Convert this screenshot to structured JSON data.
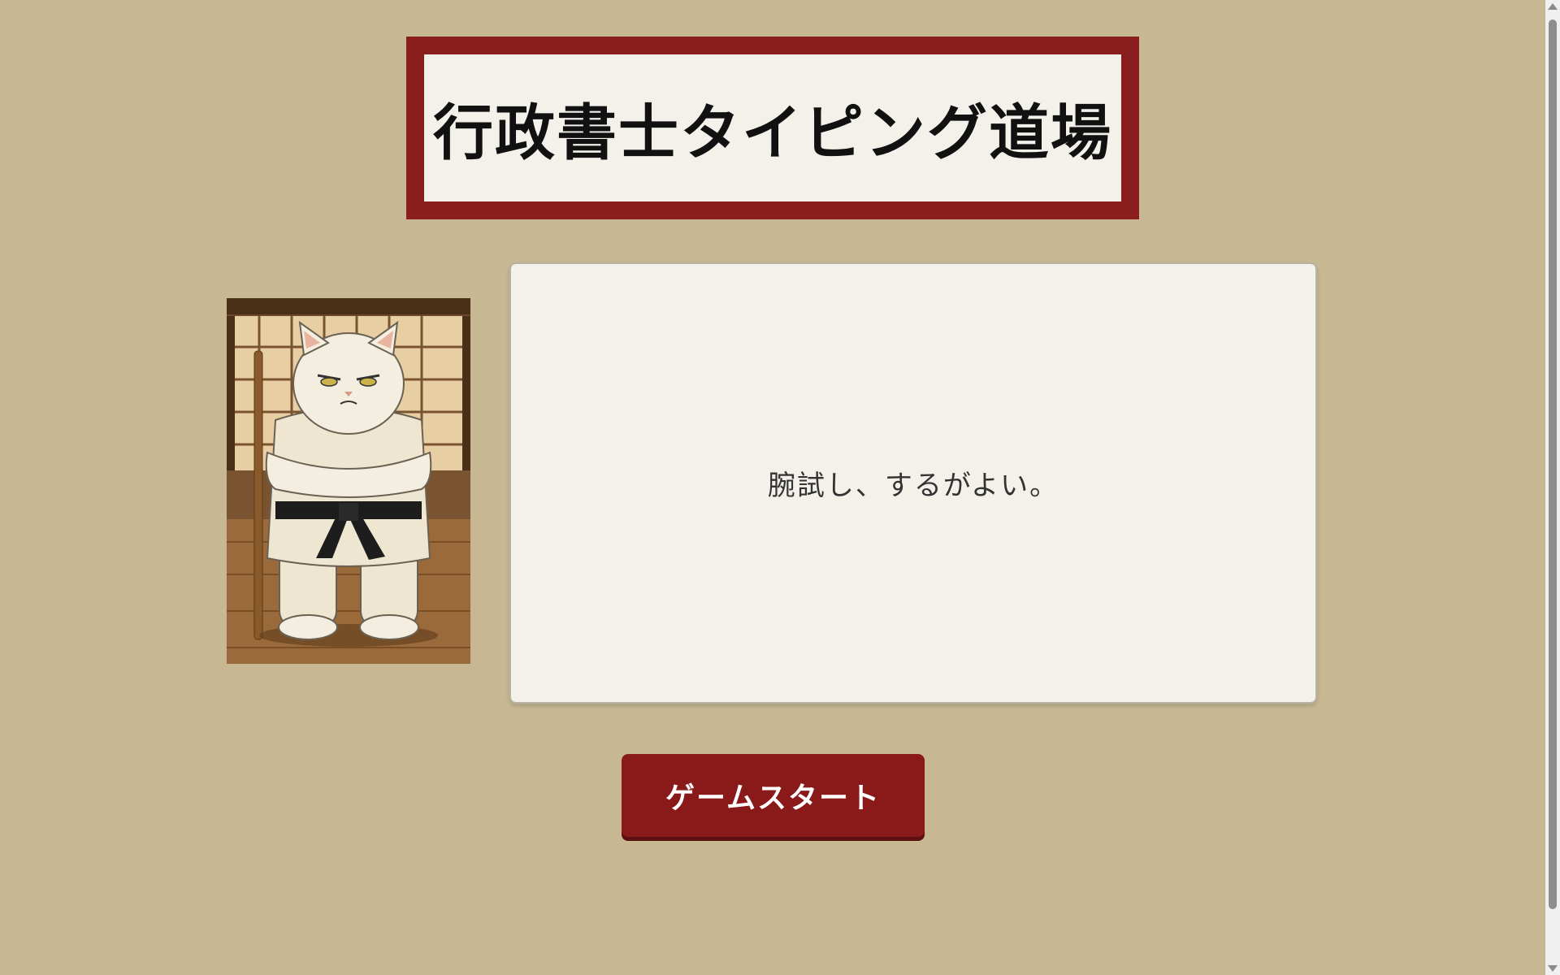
{
  "header": {
    "title": "行政書士タイピング道場"
  },
  "sensei": {
    "image_description_icon": "cat-sensei-icon"
  },
  "message_panel": {
    "text": "腕試し、するがよい。"
  },
  "start_button": {
    "label": "ゲームスタート"
  },
  "colors": {
    "background": "#c7b893",
    "accent": "#8a1e1e",
    "panel": "#f3f1ea"
  }
}
